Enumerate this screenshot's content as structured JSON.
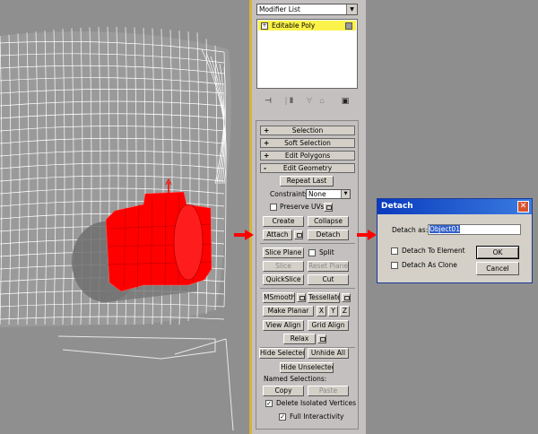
{
  "modifier_list": {
    "label": "Modifier List"
  },
  "stack": {
    "item": "Editable Poly"
  },
  "rollouts": {
    "selection": "Selection",
    "soft_selection": "Soft Selection",
    "edit_polygons": "Edit Polygons",
    "edit_geometry": "Edit Geometry",
    "plus": "+",
    "minus": "-"
  },
  "edit_geometry": {
    "repeat_last": "Repeat Last",
    "constraints_label": "Constraints:",
    "constraints_value": "None",
    "preserve_uvs": "Preserve UVs",
    "create": "Create",
    "collapse": "Collapse",
    "attach": "Attach",
    "detach": "Detach",
    "slice_plane": "Slice Plane",
    "split": "Split",
    "slice": "Slice",
    "reset_plane": "Reset Plane",
    "quickslice": "QuickSlice",
    "cut": "Cut",
    "msmooth": "MSmooth",
    "tessellate": "Tessellate",
    "make_planar": "Make Planar",
    "x": "X",
    "y": "Y",
    "z": "Z",
    "view_align": "View Align",
    "grid_align": "Grid Align",
    "relax": "Relax",
    "hide_selected": "Hide Selected",
    "unhide_all": "Unhide All",
    "hide_unselected": "Hide Unselected",
    "named_selections": "Named Selections:",
    "copy": "Copy",
    "paste": "Paste",
    "delete_isolated": "Delete Isolated Vertices",
    "full_interactivity": "Full Interactivity"
  },
  "dialog": {
    "title": "Detach",
    "detach_as_label": "Detach as:",
    "detach_as_value": "Object01",
    "detach_to_element": "Detach To Element",
    "detach_as_clone": "Detach As Clone",
    "ok": "OK",
    "cancel": "Cancel",
    "close": "✕"
  },
  "colors": {
    "selection_red": "#ff0000",
    "panel_border": "#d8b23a",
    "dialog_title": "#0a3bbd",
    "stack_highlight": "#fbf24a"
  }
}
